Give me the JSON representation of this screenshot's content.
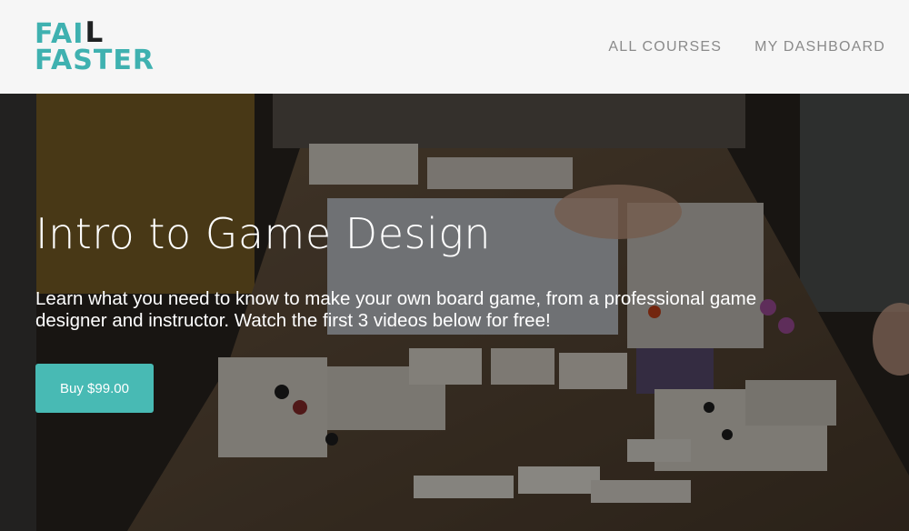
{
  "brand": {
    "logo_line1": "FAI",
    "logo_l": "L",
    "logo_line2": "FASTER",
    "accent_color": "#3fb1b0"
  },
  "nav": {
    "items": [
      {
        "label": "ALL COURSES"
      },
      {
        "label": "MY DASHBOARD"
      }
    ]
  },
  "hero": {
    "title": "Intro to Game Design",
    "description": "Learn what you need to know to make your own board game, from a professional game designer and instructor. Watch the first 3 videos below for free!",
    "buy_label": "Buy $99.00",
    "button_color": "#48bab4"
  }
}
